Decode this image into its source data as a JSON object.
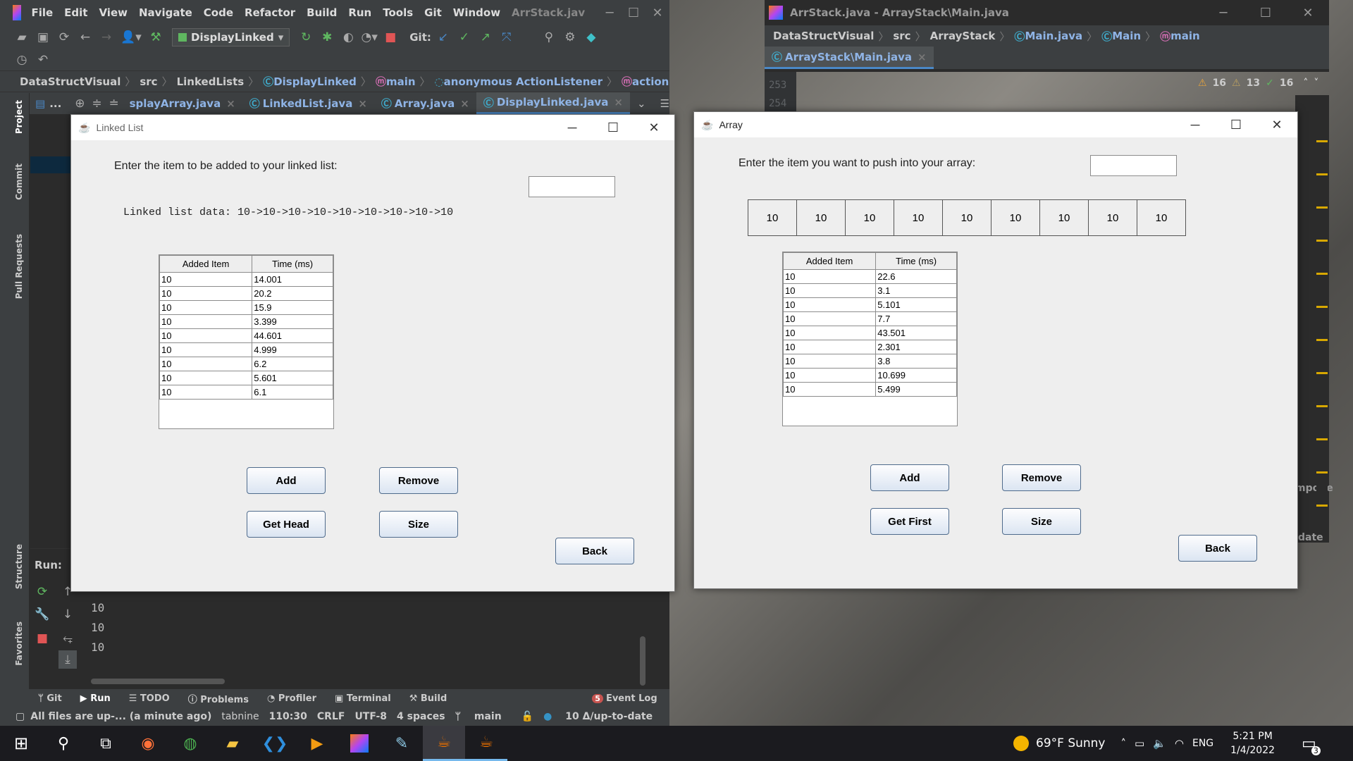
{
  "left_ide": {
    "menu": [
      "File",
      "Edit",
      "View",
      "Navigate",
      "Code",
      "Refactor",
      "Build",
      "Run",
      "Tools",
      "Git",
      "Window"
    ],
    "window_title": "ArrStack.jav",
    "run_config": "DisplayLinked",
    "git_label": "Git:",
    "breadcrumb": [
      "DataStructVisual",
      "src",
      "LinkedLists",
      "DisplayLinked",
      "main",
      "anonymous ActionListener",
      "actionPerformed"
    ],
    "tabs": [
      "splayArray.java",
      "LinkedList.java",
      "Array.java",
      "DisplayLinked.java"
    ],
    "project_label": "...",
    "side_tools": [
      "Project",
      "Commit",
      "Pull Requests",
      "Structure",
      "Favorites"
    ],
    "run_label": "Run:",
    "console_lines": [
      "10",
      "10",
      "10"
    ],
    "bottom_tabs": [
      "Git",
      "Run",
      "TODO",
      "Problems",
      "Profiler",
      "Terminal",
      "Build"
    ],
    "event_log": "Event Log",
    "event_count": "5",
    "status": {
      "files": "All files are up-... (a minute ago)",
      "tabnine": "tabnine",
      "position": "110:30",
      "line_sep": "CRLF",
      "encoding": "UTF-8",
      "indent": "4 spaces",
      "branch": "main",
      "vcs": "10 Δ/up-to-date"
    }
  },
  "right_ide": {
    "window_title": "ArrStack.java - ArrayStack\\Main.java",
    "breadcrumb": [
      "DataStructVisual",
      "src",
      "ArrayStack",
      "Main.java",
      "Main",
      "main"
    ],
    "tab": "ArrayStack\\Main.java",
    "line_numbers": [
      "253",
      "254"
    ],
    "inspections": {
      "warnings": "16",
      "weak": "13",
      "ok": "16"
    },
    "side_labels": [
      "mpone",
      "date"
    ]
  },
  "linked_list_window": {
    "title": "Linked List",
    "prompt": "Enter the item to be added to your linked list:",
    "input_value": "",
    "data_line": "Linked list data: 10->10->10->10->10->10->10->10->10",
    "table": {
      "headers": [
        "Added Item",
        "Time (ms)"
      ],
      "rows": [
        [
          "10",
          "14.001"
        ],
        [
          "10",
          "20.2"
        ],
        [
          "10",
          "15.9"
        ],
        [
          "10",
          "3.399"
        ],
        [
          "10",
          "44.601"
        ],
        [
          "10",
          "4.999"
        ],
        [
          "10",
          "6.2"
        ],
        [
          "10",
          "5.601"
        ],
        [
          "10",
          "6.1"
        ]
      ]
    },
    "buttons": {
      "add": "Add",
      "remove": "Remove",
      "get_head": "Get Head",
      "size": "Size",
      "back": "Back"
    }
  },
  "array_window": {
    "title": "Array",
    "prompt": "Enter the item you want to push into your array:",
    "input_value": "",
    "cells": [
      "10",
      "10",
      "10",
      "10",
      "10",
      "10",
      "10",
      "10",
      "10"
    ],
    "table": {
      "headers": [
        "Added Item",
        "Time (ms)"
      ],
      "rows": [
        [
          "10",
          "22.6"
        ],
        [
          "10",
          "3.1"
        ],
        [
          "10",
          "5.101"
        ],
        [
          "10",
          "7.7"
        ],
        [
          "10",
          "43.501"
        ],
        [
          "10",
          "2.301"
        ],
        [
          "10",
          "3.8"
        ],
        [
          "10",
          "10.699"
        ],
        [
          "10",
          "5.499"
        ]
      ]
    },
    "buttons": {
      "add": "Add",
      "remove": "Remove",
      "get_first": "Get First",
      "size": "Size",
      "back": "Back"
    }
  },
  "taskbar": {
    "weather": "69°F Sunny",
    "language": "ENG",
    "time": "5:21 PM",
    "date": "1/4/2022",
    "notifications": "3"
  },
  "colors": {
    "ide_bg": "#2b2b2b",
    "ide_bar": "#3c3f41",
    "accent": "#4a88c7",
    "swing_bg": "#eeeeee",
    "taskbar": "#1b1b1f"
  }
}
